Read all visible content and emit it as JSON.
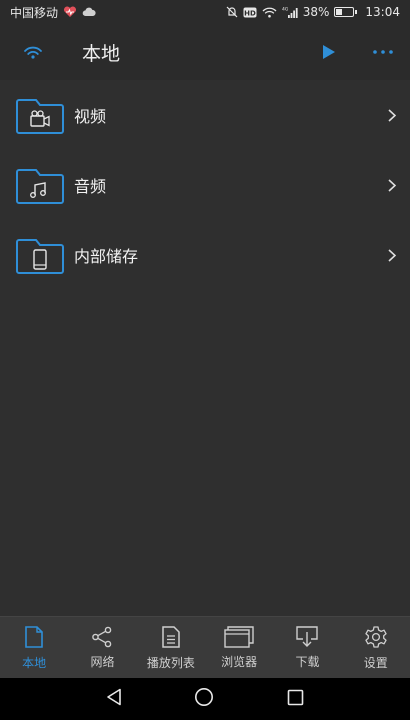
{
  "status": {
    "carrier": "中国移动",
    "battery_text": "38%",
    "battery_level": 0.38,
    "time": "13:04",
    "hd_badge": "HD",
    "network_type": "4G",
    "icons": [
      "health-icon",
      "cloud-icon",
      "mute-icon",
      "hd-icon",
      "wifi-icon",
      "signal-icon",
      "battery-icon"
    ]
  },
  "appbar": {
    "title": "本地",
    "left_icon": "wifi-icon",
    "actions": [
      "play-icon",
      "more-icon"
    ]
  },
  "list": {
    "items": [
      {
        "label": "视频",
        "icon": "video-folder-icon"
      },
      {
        "label": "音频",
        "icon": "music-folder-icon"
      },
      {
        "label": "内部储存",
        "icon": "phone-folder-icon"
      }
    ]
  },
  "tabs": [
    {
      "label": "本地",
      "icon": "file-icon",
      "active": true
    },
    {
      "label": "网络",
      "icon": "share-icon",
      "active": false
    },
    {
      "label": "播放列表",
      "icon": "playlist-icon",
      "active": false
    },
    {
      "label": "浏览器",
      "icon": "browser-icon",
      "active": false
    },
    {
      "label": "下载",
      "icon": "download-icon",
      "active": false
    },
    {
      "label": "设置",
      "icon": "settings-icon",
      "active": false
    }
  ],
  "colors": {
    "accent": "#2f8fd8",
    "background": "#2f2f2f",
    "bar": "#2b2b2b",
    "tabbar": "#3a3a3a"
  }
}
